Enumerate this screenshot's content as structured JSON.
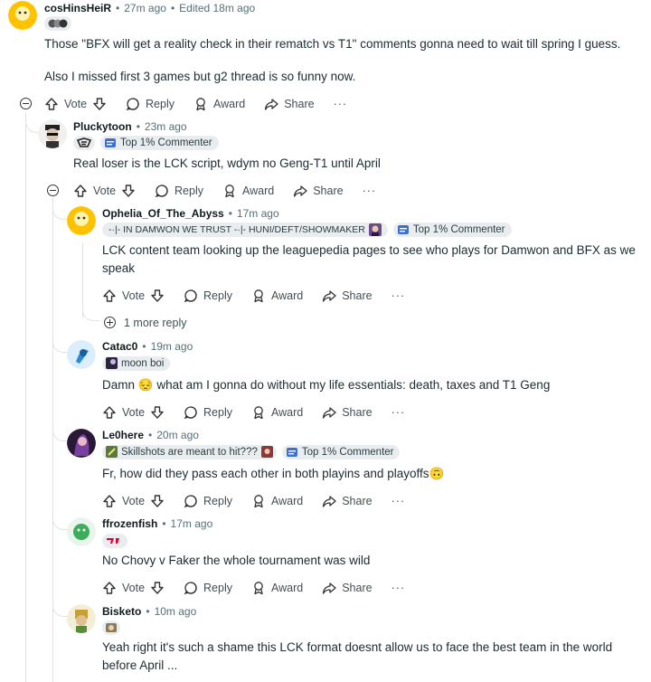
{
  "common": {
    "vote": "Vote",
    "reply": "Reply",
    "award": "Award",
    "share": "Share",
    "more": "···",
    "sep": "•",
    "top_badge": "Top 1% Commenter"
  },
  "comments": [
    {
      "user": "cosHinsHeiR",
      "time": "27m ago",
      "edited": "Edited 18m ago",
      "body": "Those \"BFX will get a reality check in their rematch vs T1\" comments gonna need to wait till spring I guess.",
      "body2": "Also I missed first 3 games but g2 thread is so funny now."
    },
    {
      "user": "Pluckytoon",
      "time": "23m ago",
      "body": "Real loser is the LCK script, wdym no Geng-T1 until April"
    },
    {
      "user": "Ophelia_Of_The_Abyss",
      "time": "17m ago",
      "flair": "-·|- IN DAMWON WE TRUST -·|- HUNI/DEFT/SHOWMAKER",
      "body": "LCK content team looking up the leaguepedia pages to see who plays for Damwon and BFX as we speak",
      "more_replies": "1 more reply"
    },
    {
      "user": "Catac0",
      "time": "19m ago",
      "flair": "moon boi",
      "body": "Damn 😔 what am I gonna do without my life essentials: death, taxes and T1 Geng"
    },
    {
      "user": "Le0here",
      "time": "20m ago",
      "flair": "Skillshots are meant to hit???",
      "body": "Fr, how did they pass each other in both playins and playoffs🙃"
    },
    {
      "user": "ffrozenfish",
      "time": "17m ago",
      "body": "No Chovy v Faker the whole tournament was wild"
    },
    {
      "user": "Bisketo",
      "time": "10m ago",
      "body": "Yeah right it's such a shame this LCK format doesnt allow us to face the best team in the world",
      "body2": "before April ..."
    }
  ],
  "colors": {
    "badge_blue": "#3b6fd6",
    "t1_red": "#e2012d",
    "avatar_yellow": "#ffc200"
  }
}
